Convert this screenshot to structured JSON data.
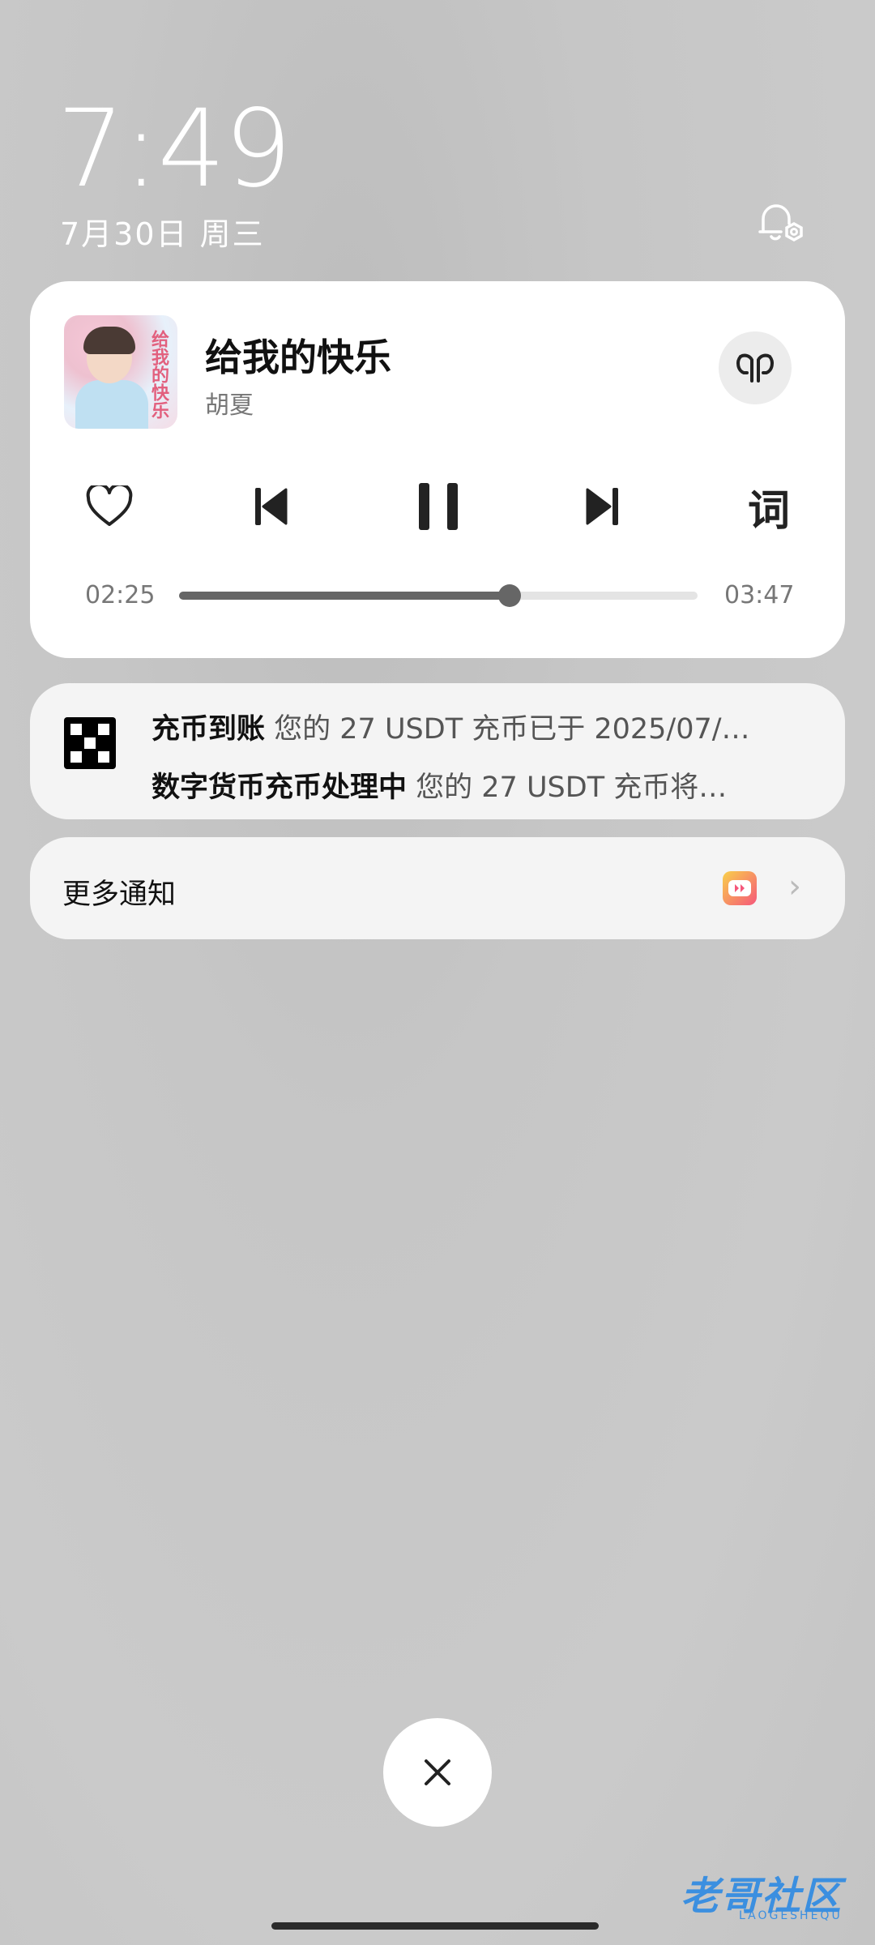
{
  "lockscreen": {
    "time": "7:49",
    "date": "7月30日 周三"
  },
  "media": {
    "song_title": "给我的快乐",
    "artist": "胡夏",
    "album_text": "给我的快乐",
    "lyrics_label": "词",
    "elapsed": "02:25",
    "duration": "03:47",
    "progress": 0.638
  },
  "notification": {
    "line1_title": "充币到账",
    "line1_body": "您的 27 USDT 充币已于 2025/07/…",
    "line2_title": "数字货币充币处理中",
    "line2_body": "您的 27 USDT 充币将…"
  },
  "more_notifications": {
    "label": "更多通知"
  },
  "watermark": {
    "text": "老哥社区",
    "sub": "LAOGESHEQU"
  },
  "colors": {
    "accent": "#666666",
    "card": "#ffffff",
    "notif_card": "#f4f4f4"
  }
}
